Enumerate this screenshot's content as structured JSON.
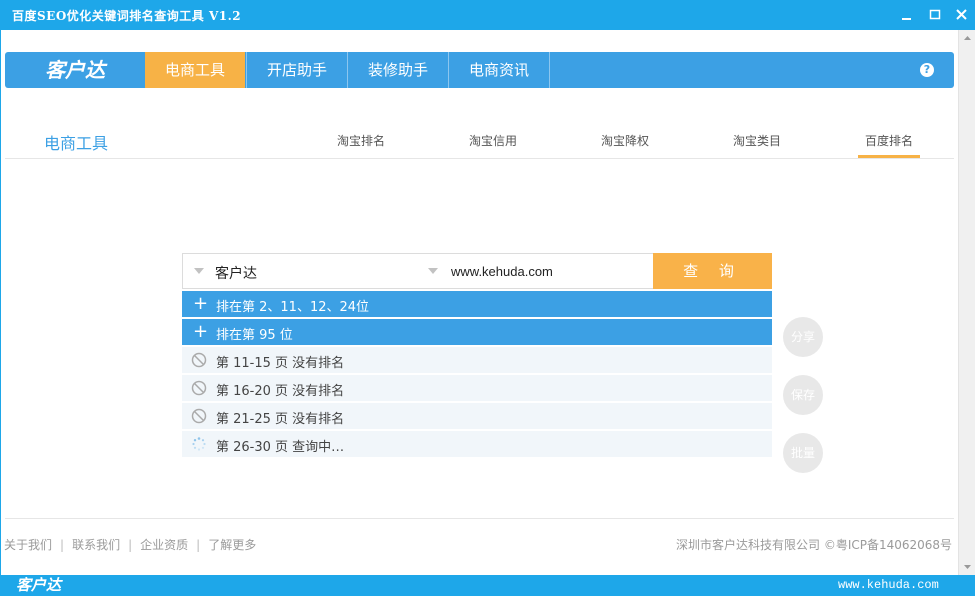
{
  "window": {
    "title": "百度SEO优化关键词排名查询工具 V1.2"
  },
  "nav": {
    "logo": "客户达",
    "items": [
      "电商工具",
      "开店助手",
      "装修助手",
      "电商资讯"
    ],
    "active_index": 0,
    "help": "?"
  },
  "section": {
    "title": "电商工具",
    "tabs": [
      "淘宝排名",
      "淘宝信用",
      "淘宝降权",
      "淘宝类目",
      "百度排名"
    ],
    "active_tab": "百度排名"
  },
  "search": {
    "keyword": "客户达",
    "site": "www.kehuda.com",
    "query_label": "查 询"
  },
  "results": [
    {
      "type": "found",
      "text": "排在第 2、11、12、24位"
    },
    {
      "type": "found",
      "text": "排在第 95 位"
    },
    {
      "type": "none",
      "text": "第 11-15 页 没有排名"
    },
    {
      "type": "none",
      "text": "第 16-20 页 没有排名"
    },
    {
      "type": "none",
      "text": "第 21-25 页 没有排名"
    },
    {
      "type": "loading",
      "text": "第 26-30 页 查询中…"
    }
  ],
  "side_buttons": [
    "分享",
    "保存",
    "批量"
  ],
  "footer": {
    "links": [
      "关于我们",
      "联系我们",
      "企业资质",
      "了解更多"
    ],
    "copyright": "深圳市客户达科技有限公司 ©粤ICP备14062068号",
    "bottom_logo": "客户达",
    "watermark": "www.kehuda.com"
  },
  "colors": {
    "titlebar": "#1ea7e9",
    "nav": "#3ca0e4",
    "accent": "#f7b246"
  }
}
